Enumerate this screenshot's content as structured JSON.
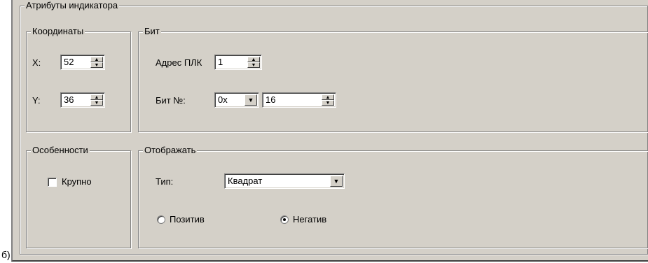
{
  "caption": "б)",
  "attributes_group": {
    "title": "Атрибуты индикатора",
    "coords": {
      "title": "Координаты",
      "x_label": "X:",
      "x_value": "52",
      "y_label": "Y:",
      "y_value": "36"
    },
    "bit": {
      "title": "Бит",
      "plc_address_label": "Адрес ПЛК",
      "plc_address_value": "1",
      "bit_no_label": "Бит №:",
      "bit_prefix_value": "0x",
      "bit_value": "16"
    },
    "features": {
      "title": "Особенности",
      "large_label": "Крупно",
      "large_checked": false
    },
    "display": {
      "title": "Отображать",
      "type_label": "Тип:",
      "type_value": "Квадрат",
      "positive_label": "Позитив",
      "negative_label": "Негатив",
      "selected": "negative"
    }
  },
  "icons": {
    "spin_up": "spin-up-arrow-icon",
    "spin_down": "spin-down-arrow-icon",
    "dropdown": "chevron-down-icon"
  }
}
